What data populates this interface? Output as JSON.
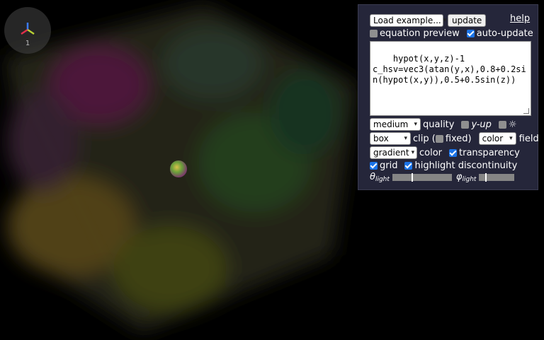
{
  "viewport": {
    "axis_widget": {
      "label": "1",
      "icon": "axes-gizmo-icon"
    },
    "cube_colors": [
      "#7a1f4a",
      "#3f5a1e",
      "#7a6a18",
      "#1f4a2a",
      "#2a5a3a"
    ]
  },
  "panel": {
    "example_select": "Load example...",
    "update_button": "update",
    "help_link": "help",
    "equation_preview": {
      "label": "equation preview",
      "checked": false
    },
    "auto_update": {
      "label": "auto-update",
      "checked": true
    },
    "equation_text": "hypot(x,y,z)-1\nc_hsv=vec3(atan(y,x),0.8+0.2sin(hypot(x,y)),0.5+0.5sin(z))",
    "quality_select": "medium",
    "quality_label": "quality",
    "y_up": {
      "label": "y-up",
      "checked": false
    },
    "light_toggle": {
      "label": "☼",
      "checked": false
    },
    "clip_select": "box",
    "clip_label_open": "clip (",
    "fixed": {
      "label": "fixed)",
      "checked": false
    },
    "field_select": "color",
    "field_label": "field",
    "color_select": "gradient",
    "color_label": "color",
    "transparency": {
      "label": "transparency",
      "checked": true
    },
    "grid": {
      "label": "grid",
      "checked": true
    },
    "highlight": {
      "label": "highlight discontinuity",
      "checked": true
    },
    "theta_light": {
      "symbol": "θ",
      "sub": "light",
      "value": 0.32
    },
    "phi_light": {
      "symbol": "φ",
      "sub": "light",
      "value": 0.18
    }
  }
}
